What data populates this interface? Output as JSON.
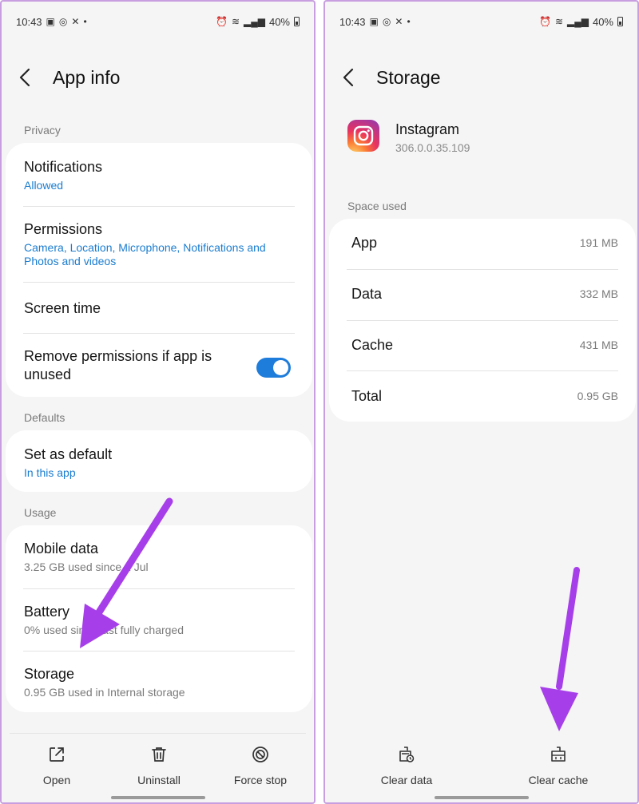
{
  "status_bar": {
    "time": "10:43",
    "battery": "40%"
  },
  "left": {
    "title": "App info",
    "sections": {
      "privacy": "Privacy",
      "defaults": "Defaults",
      "usage": "Usage"
    },
    "privacy_items": [
      {
        "title": "Notifications",
        "subtitle": "Allowed"
      },
      {
        "title": "Permissions",
        "subtitle": "Camera, Location, Microphone, Notifications and Photos and videos"
      },
      {
        "title": "Screen time"
      },
      {
        "title": "Remove permissions if app is unused",
        "toggle": true
      }
    ],
    "defaults_items": [
      {
        "title": "Set as default",
        "subtitle": "In this app"
      }
    ],
    "usage_items": [
      {
        "title": "Mobile data",
        "subtitle": "3.25 GB used since 1 Jul"
      },
      {
        "title": "Battery",
        "subtitle": "0% used since last fully charged"
      },
      {
        "title": "Storage",
        "subtitle": "0.95 GB used in Internal storage"
      }
    ],
    "bottom_actions": [
      {
        "label": "Open",
        "icon": "open-external-icon"
      },
      {
        "label": "Uninstall",
        "icon": "trash-icon"
      },
      {
        "label": "Force stop",
        "icon": "stop-icon"
      }
    ]
  },
  "right": {
    "title": "Storage",
    "app": {
      "name": "Instagram",
      "version": "306.0.0.35.109",
      "icon": "instagram-icon"
    },
    "section": "Space used",
    "rows": [
      {
        "label": "App",
        "value": "191 MB"
      },
      {
        "label": "Data",
        "value": "332 MB"
      },
      {
        "label": "Cache",
        "value": "431 MB"
      },
      {
        "label": "Total",
        "value": "0.95 GB"
      }
    ],
    "bottom_actions": [
      {
        "label": "Clear data",
        "icon": "clear-data-icon"
      },
      {
        "label": "Clear cache",
        "icon": "clear-cache-icon"
      }
    ]
  },
  "colors": {
    "accent_blue": "#1a7ccf",
    "toggle_on": "#1e7cdb",
    "annotation_arrow": "#a63fe9"
  }
}
